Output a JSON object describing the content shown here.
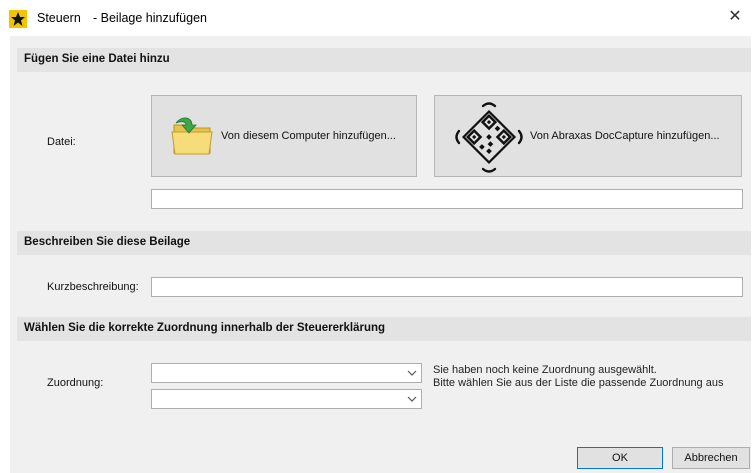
{
  "window": {
    "app_name": "Steuern",
    "title": "- Beilage hinzufügen",
    "close_glyph": "✕"
  },
  "section_file": {
    "header": "Fügen Sie eine Datei hinzu",
    "file_label": "Datei:",
    "btn_computer": "Von diesem Computer hinzufügen...",
    "btn_doccapture": "Von Abraxas DocCapture hinzufügen...",
    "file_path_value": ""
  },
  "section_describe": {
    "header": "Beschreiben Sie diese Beilage",
    "short_desc_label": "Kurzbeschreibung:",
    "short_desc_value": ""
  },
  "section_assign": {
    "header": "Wählen Sie die korrekte Zuordnung innerhalb der Steuererklärung",
    "assign_label": "Zuordnung:",
    "combo1_value": "",
    "combo2_value": "",
    "hint_line1": "Sie haben noch keine Zuordnung ausgewählt.",
    "hint_line2": "Bitte wählen Sie aus der Liste die passende Zuordnung aus"
  },
  "footer": {
    "ok_label": "OK",
    "cancel_label": "Abbrechen"
  }
}
